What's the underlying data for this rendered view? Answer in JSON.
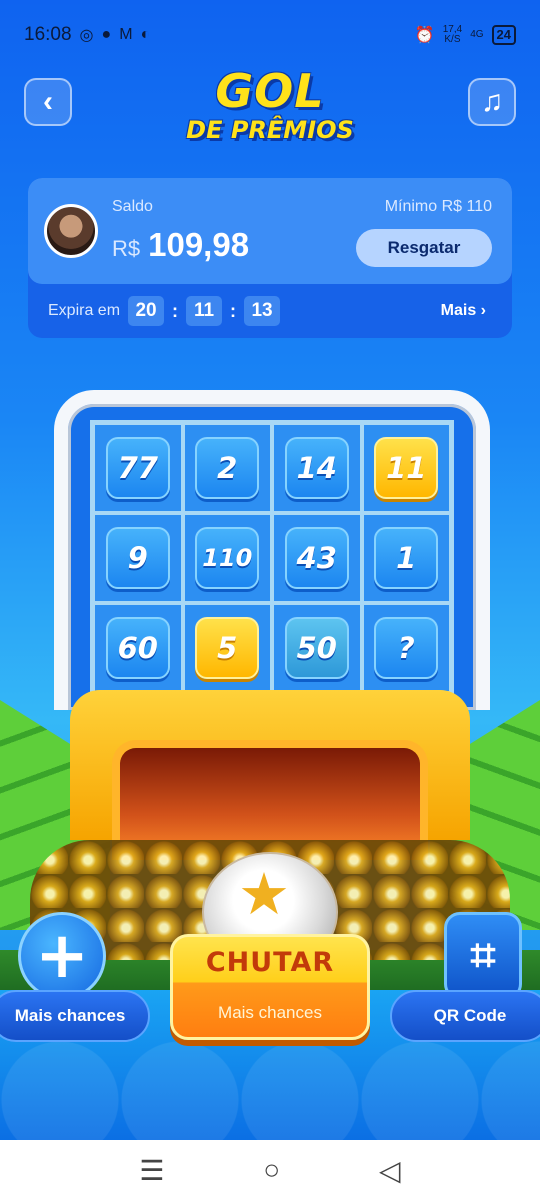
{
  "status_bar": {
    "time": "16:08",
    "left_icons": [
      "whatsapp-icon",
      "chat-icon",
      "gmail-icon",
      "app-icon"
    ],
    "net_speed_top": "17,4",
    "net_speed_bottom": "K/S",
    "network": "4G",
    "battery": "24"
  },
  "header": {
    "logo_line1": "GOL",
    "logo_line2": "DE PRÊMIOS"
  },
  "balance": {
    "label": "Saldo",
    "currency": "R$",
    "amount": "109,98",
    "minimum_label": "Mínimo  R$ 110",
    "redeem_label": "Resgatar",
    "expires_label": "Expira em",
    "hours": "20",
    "minutes": "11",
    "seconds": "13",
    "more_label": "Mais"
  },
  "grid": {
    "tiles": [
      "77",
      "2",
      "14",
      "11",
      "9",
      "110",
      "43",
      "1",
      "60",
      "5",
      "50",
      "?"
    ],
    "gold_tiles": [
      3,
      9
    ]
  },
  "controls": {
    "left_pill": "Mais chances",
    "right_pill": "QR Code",
    "kick_label": "CHUTAR",
    "kick_sub": "Mais chances"
  },
  "colors": {
    "accent_yellow": "#ffe21a",
    "primary_blue": "#1670ea",
    "kick_text": "#c23a0a"
  }
}
